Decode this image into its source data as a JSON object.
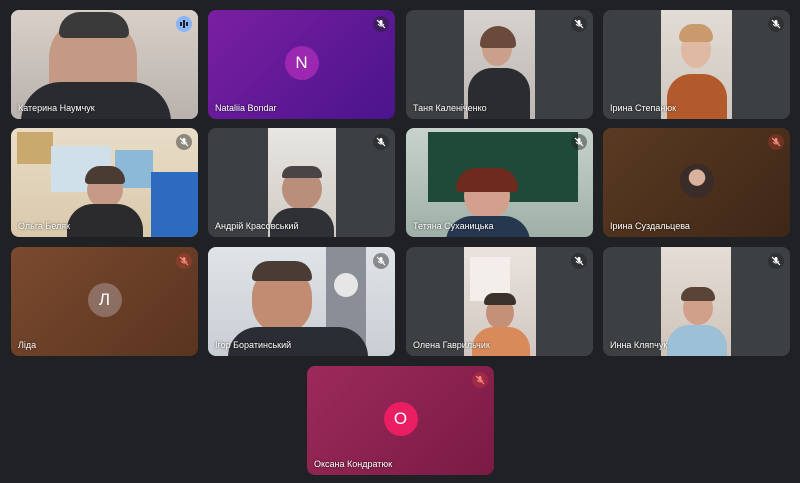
{
  "participants": [
    {
      "name": "Катерина Наумчук",
      "mic": "active",
      "speaking": true
    },
    {
      "name": "Nataliia Bondar",
      "mic": "muted",
      "avatar_letter": "N",
      "avatar_color": "#9c27b0",
      "tile_color": "#6a1b9a"
    },
    {
      "name": "Таня Каленіченко",
      "mic": "muted"
    },
    {
      "name": "Ірина Степанюк",
      "mic": "muted"
    },
    {
      "name": "Ольга Беляк",
      "mic": "muted"
    },
    {
      "name": "Андрій Красовський",
      "mic": "muted"
    },
    {
      "name": "Тетяна Суханицька",
      "mic": "muted"
    },
    {
      "name": "Ірина Суздальцева",
      "mic": "muted-red"
    },
    {
      "name": "Ліда",
      "mic": "muted-red",
      "avatar_letter": "Л",
      "avatar_color": "#8d6e63",
      "tile_color": "#6d3f2a"
    },
    {
      "name": "Ігор Боратинський",
      "mic": "muted"
    },
    {
      "name": "Олена Гаврильчик",
      "mic": "muted"
    },
    {
      "name": "Инна Кляпчук",
      "mic": "muted"
    },
    {
      "name": "Оксана Кондратюк",
      "mic": "muted-red",
      "avatar_letter": "О",
      "avatar_color": "#e91e63",
      "tile_color": "#8e1f4d"
    }
  ],
  "colors": {
    "background": "#202124",
    "speaking_outline": "#8ab4f8",
    "muted_red": "#ea4335"
  }
}
